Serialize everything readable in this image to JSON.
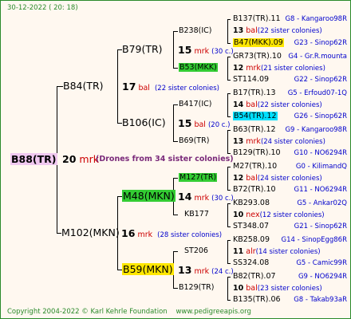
{
  "header": {
    "timestamp": "30-12-2022 ( 20: 18)"
  },
  "root": {
    "name": "B88(TR)",
    "count": "20",
    "abbrev": "mrk",
    "note": "(Drones from 34 sister colonies)"
  },
  "gen1": [
    {
      "name": "B84(TR)",
      "count": "17",
      "abbrev": "bal",
      "note": "(22 sister colonies)"
    },
    {
      "name": "M102(MKN)",
      "count": "16",
      "abbrev": "mrk",
      "note": "(28 sister colonies)"
    }
  ],
  "gen2": [
    {
      "name": "B79(TR)",
      "count": "15",
      "abbrev": "mrk",
      "note": "(30 c.)"
    },
    {
      "name": "B106(IC)",
      "count": "15",
      "abbrev": "bal",
      "note": "(20 c.)"
    },
    {
      "name": "M48(MKN)",
      "count": "14",
      "abbrev": "mrk",
      "note": "(30 c.)"
    },
    {
      "name": "B59(MKN)",
      "count": "13",
      "abbrev": "mrk",
      "note": "(24 c.)"
    }
  ],
  "gen3": [
    "B238(IC)",
    "B53(MKK)",
    "B417(IC)",
    "B69(TR)",
    "M127(TR)",
    "KB177",
    "ST206",
    "B129(TR)"
  ],
  "gen4": [
    {
      "name": "B137(TR).11",
      "code": "G8 - Kangaroo98R"
    },
    {
      "count": "13",
      "abbrev": "bal",
      "note": "(22 sister colonies)"
    },
    {
      "name": "B47(MKK).09",
      "code": "G23 - Sinop62R"
    },
    {
      "name": "GR73(TR).10",
      "code": "G4 - Gr.R.mounta"
    },
    {
      "count": "12",
      "abbrev": "mrk",
      "note": "(21 sister colonies)"
    },
    {
      "name": "ST114.09",
      "code": "G22 - Sinop62R"
    },
    {
      "name": "B17(TR).13",
      "code": "G5 - Erfoud07-1Q"
    },
    {
      "count": "14",
      "abbrev": "bal",
      "note": "(22 sister colonies)"
    },
    {
      "name": "B54(TR).12",
      "code": "G26 - Sinop62R"
    },
    {
      "name": "B63(TR).12",
      "code": "G9 - Kangaroo98R"
    },
    {
      "count": "13",
      "abbrev": "mrk",
      "note": "(24 sister colonies)"
    },
    {
      "name": "B129(TR).10",
      "code": "G10 - NO6294R"
    },
    {
      "name": "M27(TR).10",
      "code": "G0 - KilimandQ"
    },
    {
      "count": "12",
      "abbrev": "bal",
      "note": "(24 sister colonies)"
    },
    {
      "name": "B72(TR).10",
      "code": "G11 - NO6294R"
    },
    {
      "name": "KB293.08",
      "code": "G5 - Ankar02Q"
    },
    {
      "count": "10",
      "abbrev": "nex",
      "note": "(12 sister colonies)"
    },
    {
      "name": "ST348.07",
      "code": "G21 - Sinop62R"
    },
    {
      "name": "KB258.09",
      "code": "G14 - SinopEgg86R"
    },
    {
      "count": "11",
      "abbrev": "alr",
      "note": "(14 sister colonies)"
    },
    {
      "name": "SS324.08",
      "code": "G5 - Camic99R"
    },
    {
      "name": "B82(TR).07",
      "code": "G9 - NO6294R"
    },
    {
      "count": "10",
      "abbrev": "bal",
      "note": "(23 sister colonies)"
    },
    {
      "name": "B135(TR).06",
      "code": "G8 - Takab93aR"
    }
  ],
  "footer": {
    "copyright": "Copyright 2004-2022 © Karl Kehrle Foundation",
    "url": "www.pedigreeapis.org"
  },
  "colors": {
    "frame": "#2a8a2a",
    "green": "#33cc33",
    "yellow": "#ffe600",
    "pink": "#f0c8f0",
    "cyan": "#00e0ff",
    "red": "#cc0000",
    "blue": "#0000cc"
  }
}
